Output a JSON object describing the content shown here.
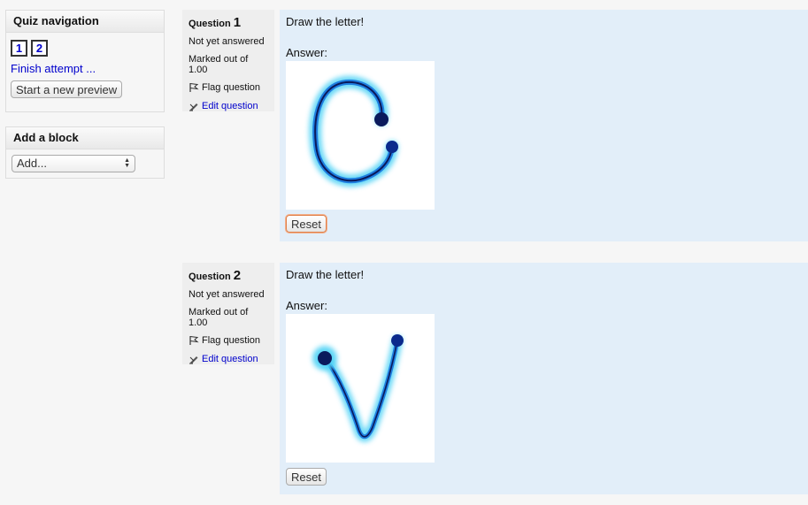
{
  "quiz_nav": {
    "title": "Quiz navigation",
    "buttons": [
      "1",
      "2"
    ],
    "finish_label": "Finish attempt ...",
    "preview_label": "Start a new preview"
  },
  "add_block": {
    "title": "Add a block",
    "select_value": "Add..."
  },
  "questions": [
    {
      "label": "Question",
      "number": "1",
      "state": "Not yet answered",
      "grade": "Marked out of 1.00",
      "flag_label": "Flag question",
      "edit_label": "Edit question",
      "text": "Draw the letter!",
      "answer_label": "Answer:",
      "reset_label": "Reset",
      "drawing": "letter-C"
    },
    {
      "label": "Question",
      "number": "2",
      "state": "Not yet answered",
      "grade": "Marked out of 1.00",
      "flag_label": "Flag question",
      "edit_label": "Edit question",
      "text": "Draw the letter!",
      "answer_label": "Answer:",
      "reset_label": "Reset",
      "drawing": "letter-V"
    }
  ],
  "colors": {
    "link": "#0000cc",
    "content_bg": "#e2eef9",
    "info_bg": "#eeeeee",
    "ink": "#0a3cc8"
  }
}
